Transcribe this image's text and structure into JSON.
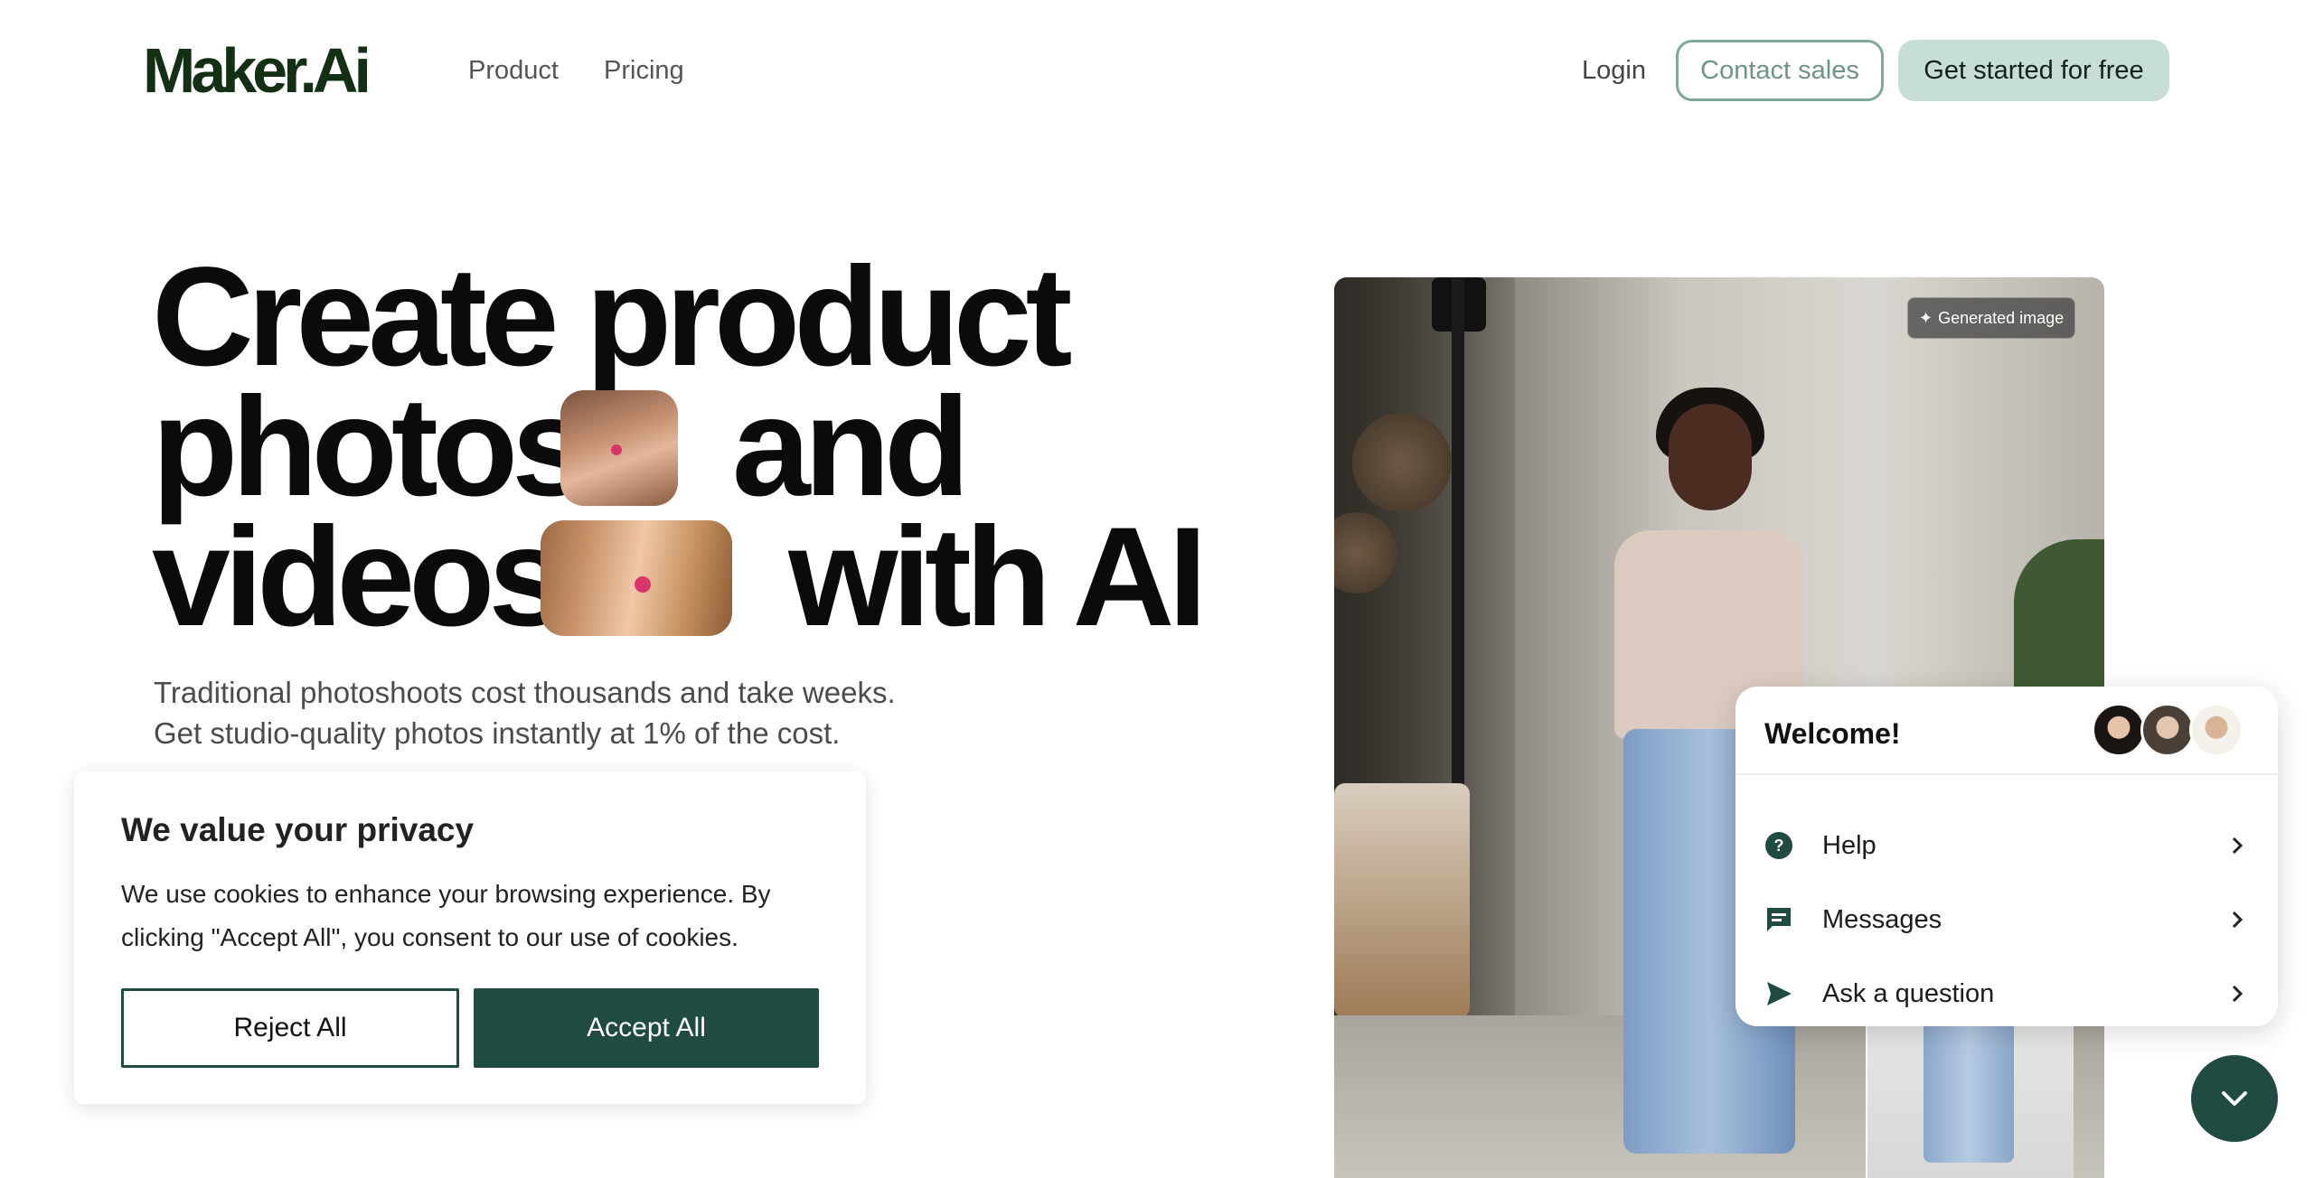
{
  "header": {
    "logo": "Maker.Ai",
    "nav": [
      "Product",
      "Pricing"
    ],
    "login": "Login",
    "contact_sales": "Contact sales",
    "get_started": "Get started for free"
  },
  "hero": {
    "line1": "Create product",
    "line2_a": "photos",
    "line2_b": "and",
    "line3_a": "videos",
    "line3_b": "with AI",
    "subtitle_1": "Traditional photoshoots cost thousands and take weeks.",
    "subtitle_2": "Get studio-quality photos instantly at 1% of the cost.",
    "image_badge": "Generated image"
  },
  "chat": {
    "title": "Welcome!",
    "items": [
      {
        "label": "Help",
        "icon": "help-icon"
      },
      {
        "label": "Messages",
        "icon": "messages-icon"
      },
      {
        "label": "Ask a question",
        "icon": "send-icon"
      }
    ]
  },
  "cookie": {
    "title": "We value your privacy",
    "text": "We use cookies to enhance your browsing experience. By clicking \"Accept All\", you consent to our use of cookies.",
    "reject": "Reject All",
    "accept": "Accept All"
  },
  "colors": {
    "brand_dark": "#1f4b43",
    "logo": "#143014",
    "cta_bg": "#c7ded5",
    "contact_border": "#7fa997"
  }
}
